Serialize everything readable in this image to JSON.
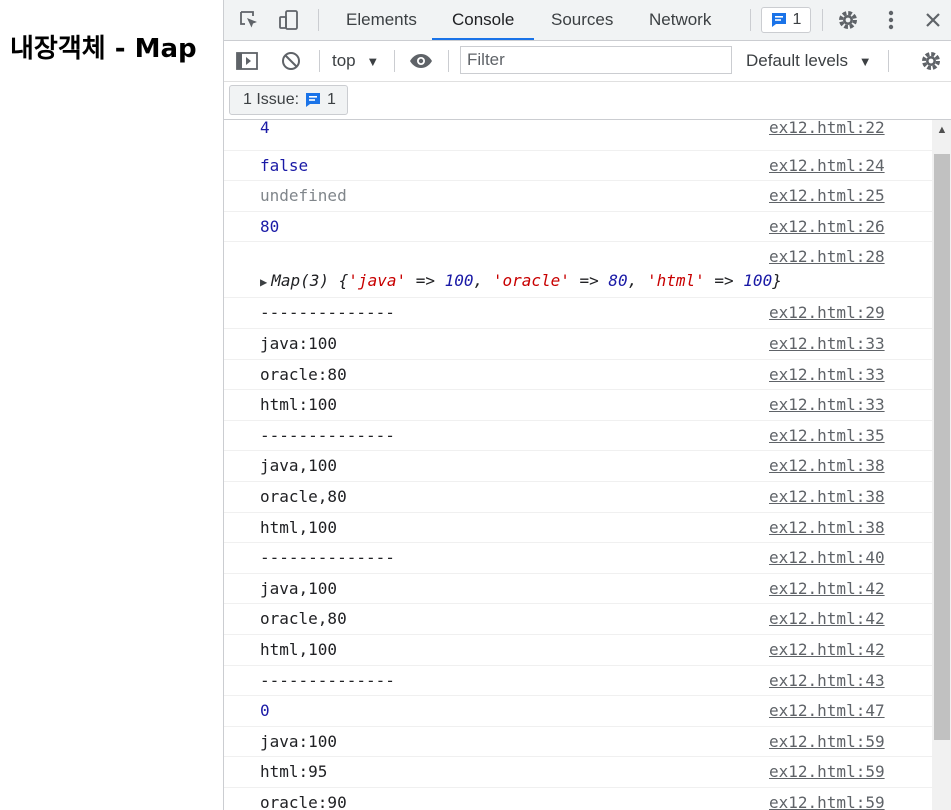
{
  "page": {
    "heading": "내장객체 - Map"
  },
  "devtools": {
    "tabs": [
      {
        "label": "Elements"
      },
      {
        "label": "Console"
      },
      {
        "label": "Sources"
      },
      {
        "label": "Network"
      }
    ],
    "issue_badge_count": "1",
    "console_toolbar": {
      "context": "top",
      "filter_placeholder": "Filter",
      "levels": "Default levels"
    },
    "issues_bar": {
      "label": "1 Issue:",
      "count": "1"
    },
    "accent_color": "#1a73e8"
  },
  "console_rows": [
    {
      "message": "4",
      "source": "ex12.html:22"
    },
    {
      "message": "false",
      "source": "ex12.html:24"
    },
    {
      "message": "undefined",
      "source": "ex12.html:25"
    },
    {
      "message": "80",
      "source": "ex12.html:26"
    },
    {
      "message": "",
      "source": "ex12.html:28"
    },
    {
      "message": "--------------",
      "source": "ex12.html:29"
    },
    {
      "message": "java:100",
      "source": "ex12.html:33"
    },
    {
      "message": "oracle:80",
      "source": "ex12.html:33"
    },
    {
      "message": "html:100",
      "source": "ex12.html:33"
    },
    {
      "message": "--------------",
      "source": "ex12.html:35"
    },
    {
      "message": "java,100",
      "source": "ex12.html:38"
    },
    {
      "message": "oracle,80",
      "source": "ex12.html:38"
    },
    {
      "message": "html,100",
      "source": "ex12.html:38"
    },
    {
      "message": "--------------",
      "source": "ex12.html:40"
    },
    {
      "message": "java,100",
      "source": "ex12.html:42"
    },
    {
      "message": "oracle,80",
      "source": "ex12.html:42"
    },
    {
      "message": "html,100",
      "source": "ex12.html:42"
    },
    {
      "message": "--------------",
      "source": "ex12.html:43"
    },
    {
      "message": "0",
      "source": "ex12.html:47"
    },
    {
      "message": "java:100",
      "source": "ex12.html:59"
    },
    {
      "message": "html:95",
      "source": "ex12.html:59"
    },
    {
      "message": "oracle:90",
      "source": "ex12.html:59"
    }
  ],
  "map_preview": {
    "prefix": "Map(3) {",
    "entries": [
      {
        "key": "'java'",
        "value": "100"
      },
      {
        "key": "'oracle'",
        "value": "80"
      },
      {
        "key": "'html'",
        "value": "100"
      }
    ],
    "arrow": "=>",
    "suffix": "}"
  }
}
